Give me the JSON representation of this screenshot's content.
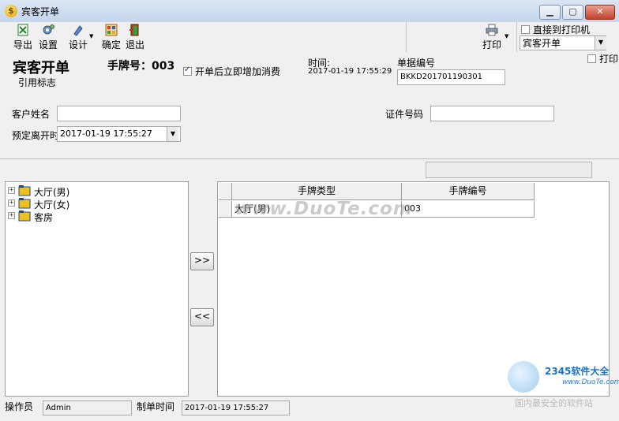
{
  "window": {
    "title": "宾客开单"
  },
  "toolbar": {
    "export_label": "导出",
    "settings_label": "设置",
    "design_label": "设计",
    "confirm_label": "确定",
    "exit_label": "退出",
    "print_label": "打印",
    "direct_print_label": "直接到打印机",
    "print_template_value": "宾客开单"
  },
  "form": {
    "heading": "宾客开单",
    "subheading": "引用标志",
    "tag_label": "手牌号：003",
    "add_consumption_label": "开单后立即增加消费",
    "time_label": "时间:",
    "time_value": "2017-01-19 17:55:29",
    "doc_no_label": "单据编号",
    "doc_no_value": "BKKD201701190301",
    "print_checkbox_label": "打印",
    "customer_name_label": "客户姓名",
    "customer_name_value": "",
    "id_no_label": "证件号码",
    "id_no_value": "",
    "departure_label": "预定离开时间",
    "departure_value": "2017-01-19 17:55:27"
  },
  "tree": {
    "items": [
      {
        "label": "大厅(男)"
      },
      {
        "label": "大厅(女)"
      },
      {
        "label": "客房"
      }
    ]
  },
  "move_buttons": {
    "add": ">>",
    "remove": "<<"
  },
  "grid": {
    "columns": [
      "手牌类型",
      "手牌编号"
    ],
    "rows": [
      {
        "type": "大厅(男)",
        "no": "003"
      }
    ]
  },
  "status": {
    "operator_label": "操作员",
    "operator_value": "Admin",
    "created_time_label": "制单时间",
    "created_time_value": "2017-01-19 17:55:27"
  },
  "watermark": {
    "main": "www.DuoTe.com",
    "logo_text": "2345软件大全",
    "logo_url": "www.DuoTe.com",
    "logo_caption": "国内最安全的软件站"
  }
}
